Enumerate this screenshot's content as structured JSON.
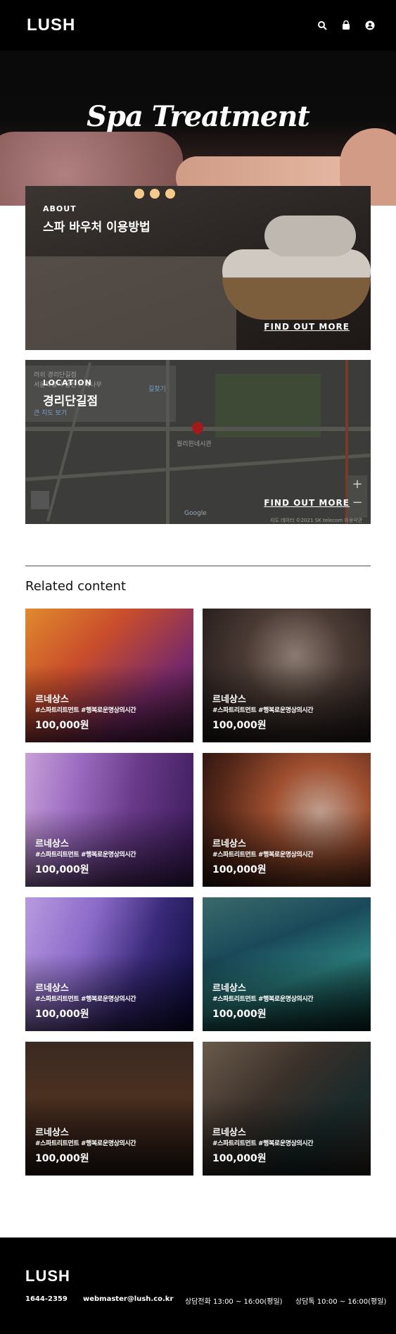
{
  "header": {
    "logo": "LUSH",
    "icons": [
      "search-icon",
      "bag-icon",
      "user-icon"
    ]
  },
  "hero": {
    "title": "Spa Treatment"
  },
  "cards": [
    {
      "label": "ABOUT",
      "title": "스파 바우처 이용방법",
      "link": "FIND OUT MORE"
    },
    {
      "label": "LOCATION",
      "title": "경리단길점",
      "link": "FIND OUT MORE"
    }
  ],
  "map": {
    "place": "러쉬 경리단길점",
    "address": "서울특별시 용산구 회나무",
    "directions": "길찾기",
    "larger_map": "큰 지도 보기",
    "pin_label": "월리윈네시관",
    "attribution": "지도 데이터 ©2021 SK telecom   이용약관",
    "google": "Google"
  },
  "related": {
    "title": "Related content",
    "items": [
      {
        "name": "르네상스",
        "tags": "#스파트리트먼트 #행복로운명상의시간",
        "price": "100,000원"
      },
      {
        "name": "르네상스",
        "tags": "#스파트리트먼트 #행복로운명상의시간",
        "price": "100,000원"
      },
      {
        "name": "르네상스",
        "tags": "#스파트리트먼트 #행복로운명상의시간",
        "price": "100,000원"
      },
      {
        "name": "르네상스",
        "tags": "#스파트리트먼트 #행복로운명상의시간",
        "price": "100,000원"
      },
      {
        "name": "르네상스",
        "tags": "#스파트리트먼트 #행복로운명상의시간",
        "price": "100,000원"
      },
      {
        "name": "르네상스",
        "tags": "#스파트리트먼트 #행복로운명상의시간",
        "price": "100,000원"
      },
      {
        "name": "르네상스",
        "tags": "#스파트리트먼트 #행복로운명상의시간",
        "price": "100,000원"
      },
      {
        "name": "르네상스",
        "tags": "#스파트리트먼트 #행복로운명상의시간",
        "price": "100,000원"
      }
    ]
  },
  "footer": {
    "logo": "LUSH",
    "phone": "1644-2359",
    "email": "webmaster@lush.co.kr",
    "consult_phone": "상담전화 13:00 ~ 16:00(평일)",
    "consult_chat": "상담톡 10:00 ~ 16:00(평일)"
  }
}
